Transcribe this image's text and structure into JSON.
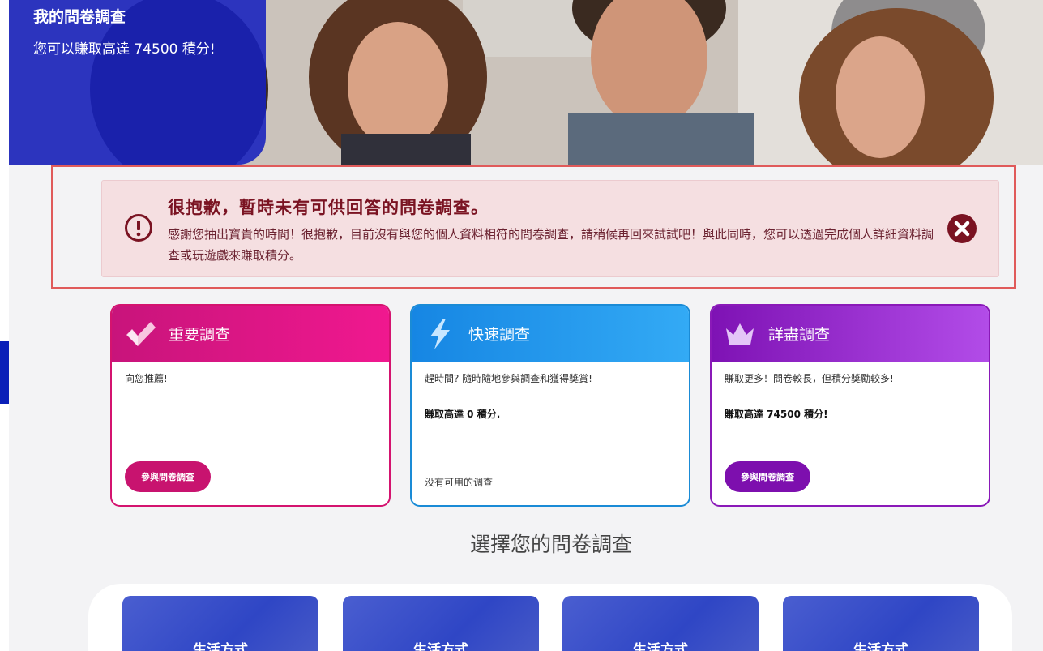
{
  "hero": {
    "title": "我的問卷調查",
    "subtitle": "您可以賺取高達 74500 積分!"
  },
  "alert": {
    "title": "很抱歉，暫時未有可供回答的問卷調查。",
    "body": "感謝您抽出寶貴的時間！很抱歉，目前沒有與您的個人資料相符的問卷調查，請稍候再回來試試吧！與此同時，您可以透過完成個人詳細資料調查或玩遊戲來賺取積分。",
    "icon": "exclamation-circle-icon",
    "close_icon": "close-circle-icon",
    "color": "#7a1322"
  },
  "cards": [
    {
      "title": "重要調查",
      "icon": "checkmark-icon",
      "description": "向您推薦!",
      "button": "參與問卷調查",
      "color": "#d4136f"
    },
    {
      "title": "快速調查",
      "icon": "lightning-bolt-icon",
      "description": "趕時間? 隨時隨地參與調查和獲得獎賞!",
      "points": "賺取高達 0 積分.",
      "empty_text": "没有可用的调查",
      "color": "#1a8bd6"
    },
    {
      "title": "詳盡調查",
      "icon": "crown-icon",
      "description": "賺取更多！問卷較長，但積分獎勵較多!",
      "points": "賺取高達 74500 積分!",
      "button": "參與問卷調查",
      "color": "#8a19b8"
    }
  ],
  "section_title": "選擇您的問卷調查",
  "categories": [
    "生活方式",
    "生活方式",
    "生活方式",
    "生活方式"
  ]
}
